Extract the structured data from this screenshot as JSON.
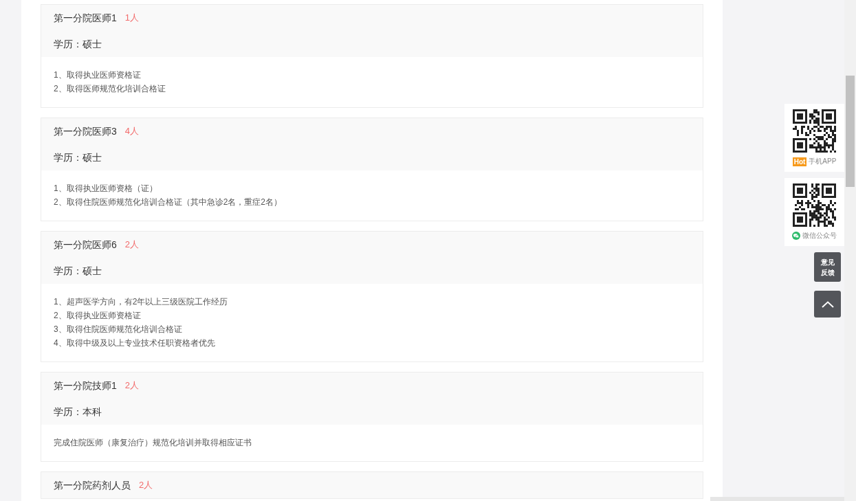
{
  "posts": [
    {
      "title": "第一分院医师1",
      "count": "1人",
      "education": "学历：硕士",
      "requirements": [
        "1、取得执业医师资格证",
        "2、取得医师规范化培训合格证"
      ]
    },
    {
      "title": "第一分院医师3",
      "count": "4人",
      "education": "学历：硕士",
      "requirements": [
        "1、取得执业医师资格（证）",
        "2、取得住院医师规范化培训合格证（其中急诊2名，重症2名）"
      ]
    },
    {
      "title": "第一分院医师6",
      "count": "2人",
      "education": "学历：硕士",
      "requirements": [
        "1、超声医学方向，有2年以上三级医院工作经历",
        "2、取得执业医师资格证",
        "3、取得住院医师规范化培训合格证",
        "4、取得中级及以上专业技术任职资格者优先"
      ]
    },
    {
      "title": "第一分院技师1",
      "count": "2人",
      "education": "学历：本科",
      "requirements": [
        "完成住院医师（康复治疗）规范化培训并取得相应证书"
      ]
    },
    {
      "title": "第一分院药剂人员",
      "count": "2人"
    }
  ],
  "side_panel": {
    "app_qr": {
      "badge": "Hot",
      "label": "手机APP"
    },
    "wechat_qr": {
      "label": "微信公众号"
    },
    "feedback_button": "意见反馈"
  }
}
